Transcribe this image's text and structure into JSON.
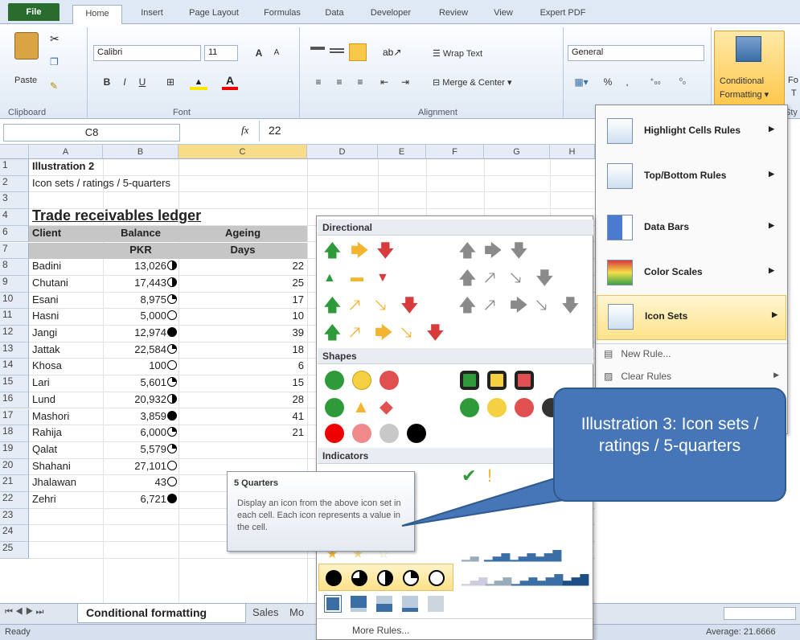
{
  "tabs": [
    "File",
    "Home",
    "Insert",
    "Page Layout",
    "Formulas",
    "Data",
    "Developer",
    "Review",
    "View",
    "Expert PDF"
  ],
  "ribbon": {
    "paste": "Paste",
    "font_name": "Calibri",
    "font_size": "11",
    "wrap_text": "Wrap Text",
    "merge_center": "Merge & Center",
    "number_format": "General",
    "cond_fmt_1": "Conditional",
    "cond_fmt_2": "Formatting",
    "format_as_1": "Fo",
    "format_as_2": "T",
    "groups": {
      "clipboard": "Clipboard",
      "font": "Font",
      "alignment": "Alignment",
      "styles": "Sty"
    }
  },
  "formula_bar": {
    "name_box": "C8",
    "fx": "fx",
    "value": "22"
  },
  "columns": [
    "A",
    "B",
    "C",
    "D",
    "E",
    "F",
    "G",
    "H"
  ],
  "rows": [
    {
      "n": "1",
      "a": "Illustration 2",
      "b": "",
      "c": "",
      "bold": true
    },
    {
      "n": "2",
      "a": "Icon sets / ratings / 5-quarters",
      "b": "",
      "c": ""
    },
    {
      "n": "3",
      "a": "",
      "b": "",
      "c": ""
    },
    {
      "n": "4",
      "a": "Trade receivables ledger",
      "b": "",
      "c": "",
      "title": true
    },
    {
      "n": "6",
      "a": "Client",
      "b": "Balance",
      "c": "Ageing",
      "hdr": true
    },
    {
      "n": "7",
      "a": "",
      "b": "PKR",
      "c": "Days",
      "hdr": true
    },
    {
      "n": "8",
      "a": "Badini",
      "b": "13,026",
      "c": "22",
      "icon": "half"
    },
    {
      "n": "9",
      "a": "Chutani",
      "b": "17,443",
      "c": "25",
      "icon": "half"
    },
    {
      "n": "10",
      "a": "Esani",
      "b": "8,975",
      "c": "17",
      "icon": "quarter"
    },
    {
      "n": "11",
      "a": "Hasni",
      "b": "5,000",
      "c": "10",
      "icon": "empty"
    },
    {
      "n": "12",
      "a": "Jangi",
      "b": "12,974",
      "c": "39",
      "icon": "full"
    },
    {
      "n": "13",
      "a": "Jattak",
      "b": "22,584",
      "c": "18",
      "icon": "quarter"
    },
    {
      "n": "14",
      "a": "Khosa",
      "b": "100",
      "c": "6",
      "icon": "empty"
    },
    {
      "n": "15",
      "a": "Lari",
      "b": "5,601",
      "c": "15",
      "icon": "quarter"
    },
    {
      "n": "16",
      "a": "Lund",
      "b": "20,932",
      "c": "28",
      "icon": "half"
    },
    {
      "n": "17",
      "a": "Mashori",
      "b": "3,859",
      "c": "41",
      "icon": "full"
    },
    {
      "n": "18",
      "a": "Rahija",
      "b": "6,000",
      "c": "21",
      "icon": "quarter"
    },
    {
      "n": "19",
      "a": "Qalat",
      "b": "5,579",
      "c": "",
      "icon": "quarter"
    },
    {
      "n": "20",
      "a": "Shahani",
      "b": "27,101",
      "c": "",
      "icon": "empty"
    },
    {
      "n": "21",
      "a": "Jhalawan",
      "b": "43",
      "c": "",
      "icon": "empty"
    },
    {
      "n": "22",
      "a": "Zehri",
      "b": "6,721",
      "c": "",
      "icon": "full"
    },
    {
      "n": "23",
      "a": "",
      "b": "",
      "c": ""
    },
    {
      "n": "24",
      "a": "",
      "b": "",
      "c": ""
    },
    {
      "n": "25",
      "a": "",
      "b": "",
      "c": ""
    }
  ],
  "cf_menu": {
    "highlight": "Highlight Cells Rules",
    "topbottom": "Top/Bottom Rules",
    "databars": "Data Bars",
    "colorscales": "Color Scales",
    "iconsets": "Icon Sets",
    "newrule": "New Rule...",
    "clearrules": "Clear Rules"
  },
  "iconsets_panel": {
    "directional": "Directional",
    "shapes": "Shapes",
    "indicators": "Indicators",
    "more_rules": "More Rules..."
  },
  "tooltip": {
    "title": "5 Quarters",
    "body": "Display an icon from the above icon set in each cell. Each icon represents a value in the cell."
  },
  "callout": "Illustration 3: Icon sets / ratings / 5-quarters",
  "sheet_tabs": [
    "Conditional formatting",
    "Sales",
    "Mo"
  ],
  "status": {
    "ready": "Ready",
    "average": "Average: 21.6666"
  },
  "colors": {
    "green": "#2e9a3a",
    "amber": "#f5b430",
    "red": "#d83b3b",
    "grey": "#8a8a8a",
    "callout": "#4675b8"
  }
}
